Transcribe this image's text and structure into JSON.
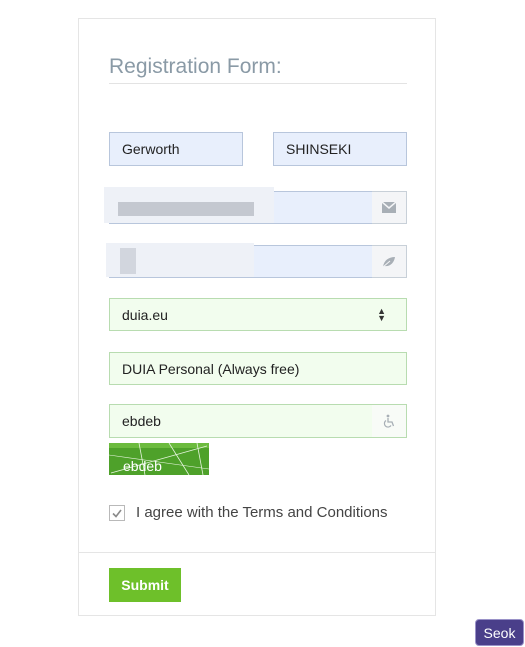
{
  "form": {
    "title": "Registration Form:",
    "first_name": "Gerworth",
    "last_name": "SHINSEKI",
    "domain_select": "duia.eu",
    "plan": "DUIA Personal (Always free)",
    "captcha_input": "ebdeb",
    "captcha_text": "ebdeb",
    "agree_label": "I agree with the Terms and Conditions",
    "agree_checked": true,
    "submit_label": "Submit"
  },
  "icons": {
    "email": "envelope-icon",
    "password": "leaf-icon",
    "captcha": "wheelchair-icon",
    "select": "sort-arrows-icon"
  },
  "floating_button": {
    "label": "Seok"
  },
  "colors": {
    "submit": "#6ec02a",
    "title": "#8a9aa6",
    "autofill_blue": "#e8effc",
    "valid_green": "#f2fdee",
    "seok_button": "#4a3f8a"
  }
}
